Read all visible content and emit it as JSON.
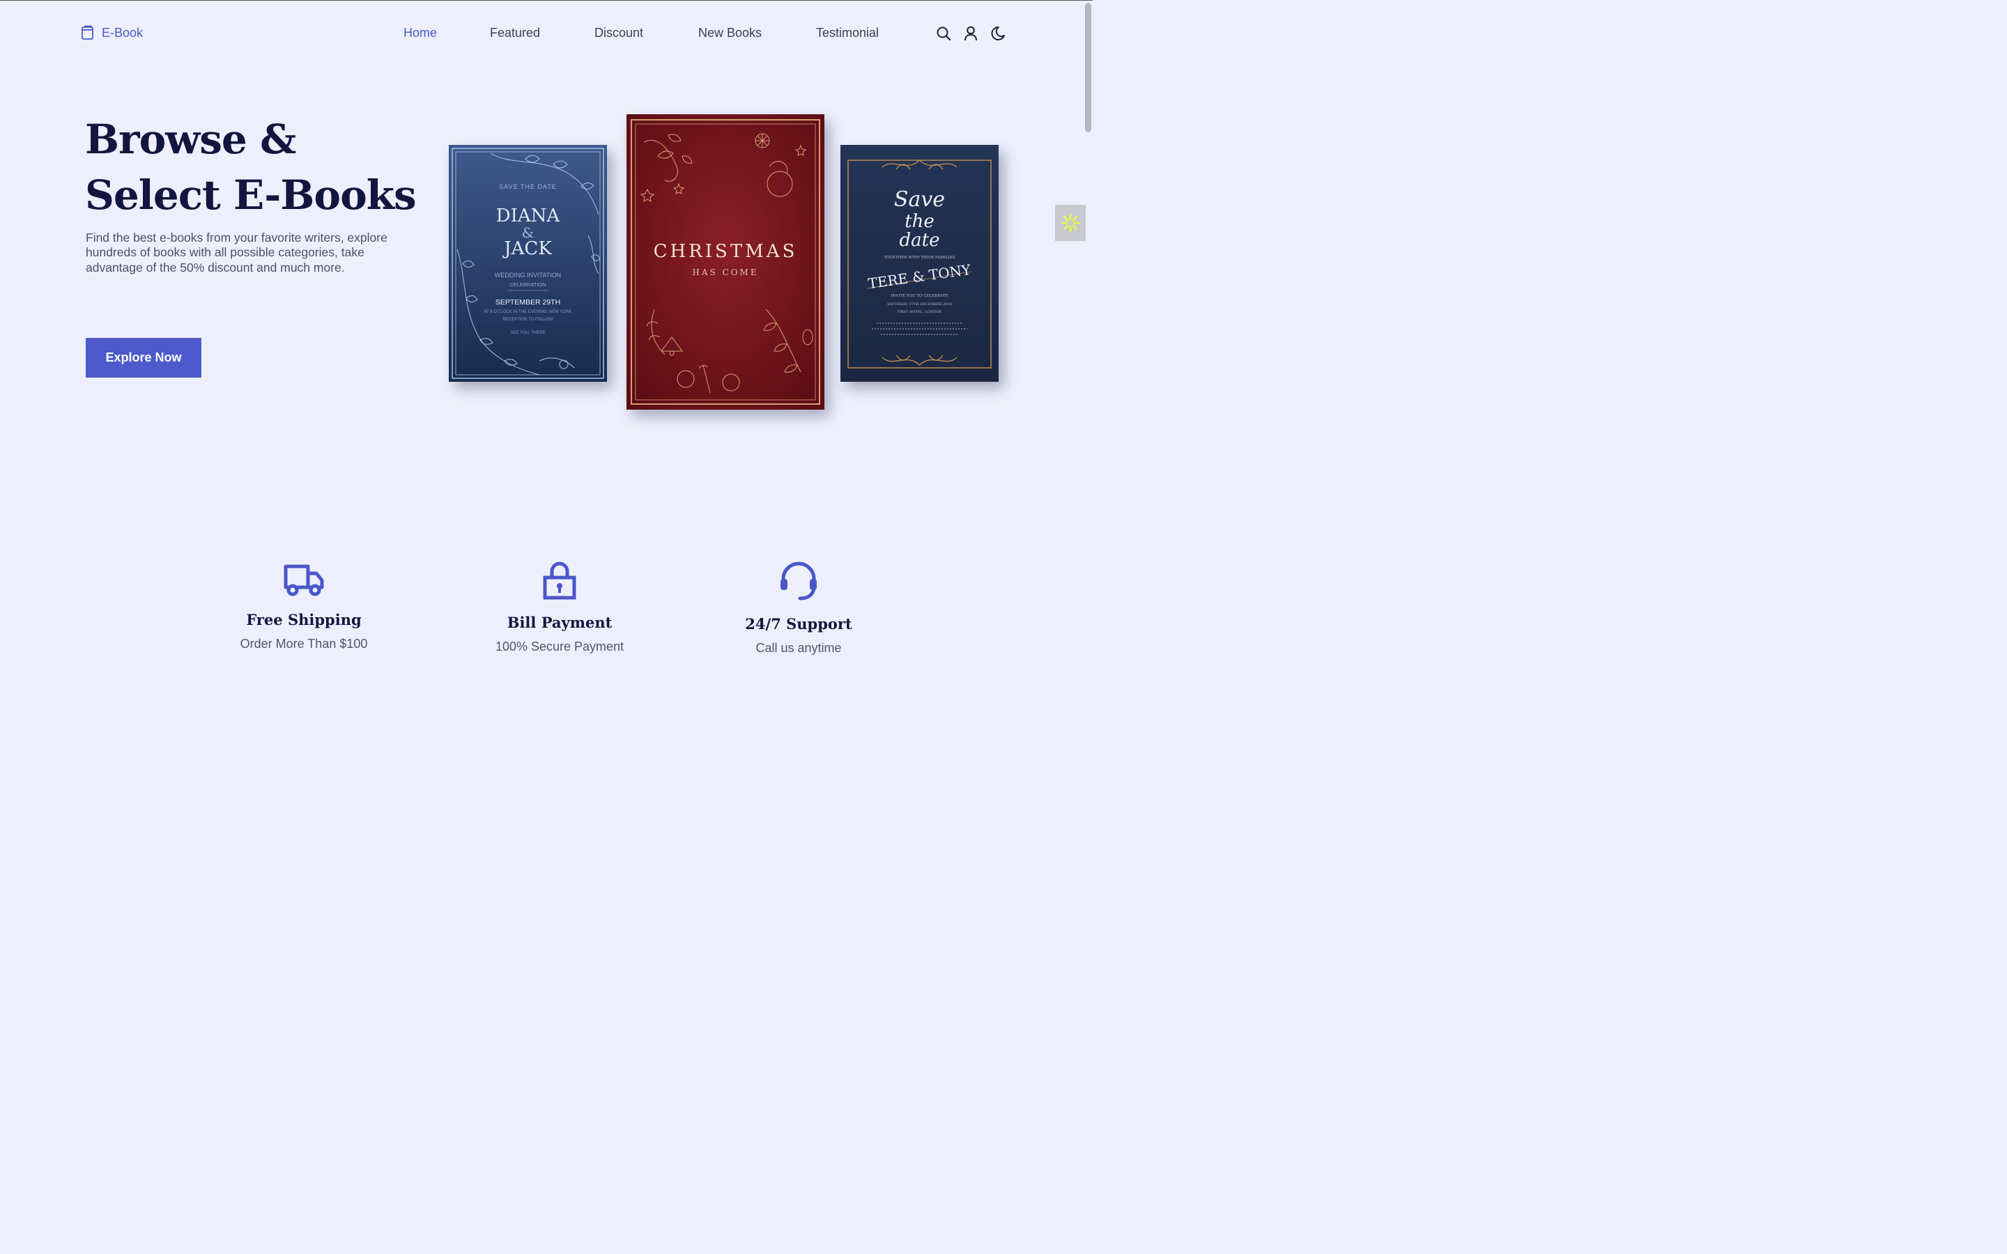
{
  "header": {
    "logo_text": "E-Book",
    "nav": [
      "Home",
      "Featured",
      "Discount",
      "New Books",
      "Testimonial"
    ],
    "active_index": 0,
    "icons": [
      "search-icon",
      "user-icon",
      "moon-icon"
    ]
  },
  "hero": {
    "title_line1": "Browse &",
    "title_line2": "Select E-Books",
    "description": "Find the best e-books from your favorite writers, explore hundreds of books with all possible categories, take advantage of the 50% discount and much more.",
    "button_label": "Explore Now"
  },
  "books": [
    {
      "save": "SAVE THE DATE",
      "name1": "DIANA",
      "amp": "&",
      "name2": "JACK",
      "line1": "WEDDING INVITATION",
      "line2": "CELEBRATION",
      "date": "SEPTEMBER 29TH",
      "line3": "AT 6 O'CLOCK IN THE EVENING, NEW YORK",
      "line4": "RECEPTION TO FOLLOW",
      "line5": "SEE YOU, THERE"
    },
    {
      "title": "CHRISTMAS",
      "subtitle": "HAS COME"
    },
    {
      "script1": "Save",
      "script2": "the",
      "script3": "date",
      "together": "TOGETHER WITH THEIR FAMILIES",
      "names": "TERE & TONY",
      "invite": "INVITE YOU TO CELEBRATE",
      "date": "SATURDAY, 27TH DECEMBER 2018",
      "venue": "FIRST HOTEL, LONDON"
    }
  ],
  "features": [
    {
      "icon": "truck-icon",
      "title": "Free Shipping",
      "subtitle": "Order More Than $100"
    },
    {
      "icon": "lock-icon",
      "title": "Bill Payment",
      "subtitle": "100% Secure Payment"
    },
    {
      "icon": "headset-icon",
      "title": "24/7 Support",
      "subtitle": "Call us anytime"
    }
  ],
  "colors": {
    "accent": "#4a57c9",
    "background": "#edf0fc",
    "heading": "#12163f"
  }
}
